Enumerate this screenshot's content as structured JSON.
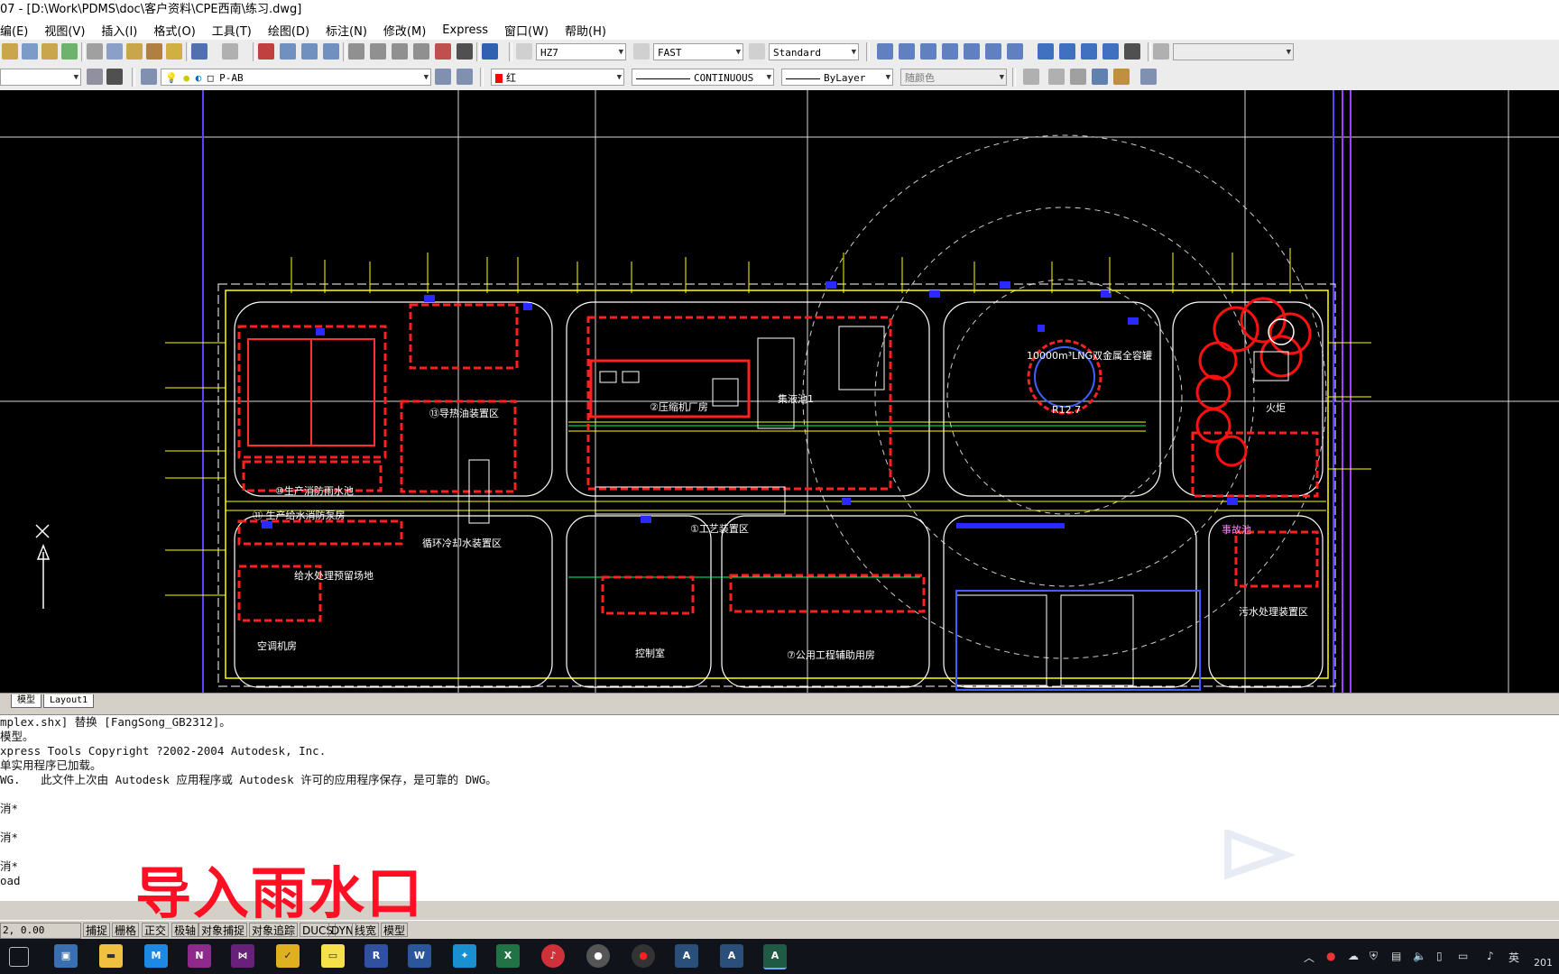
{
  "window": {
    "title": "07 - [D:\\Work\\PDMS\\doc\\客户资料\\CPE西南\\练习.dwg]"
  },
  "menu": [
    "编(E)",
    "视图(V)",
    "插入(I)",
    "格式(O)",
    "工具(T)",
    "绘图(D)",
    "标注(N)",
    "修改(M)",
    "Express",
    "窗口(W)",
    "帮助(H)"
  ],
  "toolbar1": {
    "text_style": "HZ7",
    "dim_style": "FAST",
    "table_style": "Standard"
  },
  "toolbar2": {
    "layer": "P-AB",
    "color": "红",
    "linetype": "CONTINUOUS",
    "lineweight": "ByLayer",
    "plotstyle": "随颜色"
  },
  "drawing": {
    "labels": {
      "a": "⑩生产消防雨水池",
      "b": "⑪ 生产给水消防泵房",
      "c": "⑬导热油装置区",
      "d": "循环冷却水装置区",
      "e": "②压缩机厂房",
      "f": "①工艺装置区",
      "g": "10000m³LNG双金属全容罐",
      "h": "火炬",
      "i": "给水处理预留场地",
      "j": "污水处理装置区",
      "k": "空调机房",
      "l": "控制室",
      "m": "⑦公用工程辅助用房",
      "n": "事故池",
      "o": "集液池1",
      "p": "R12.7"
    }
  },
  "tabs": {
    "model": "模型",
    "layout1": "Layout1"
  },
  "command_lines": [
    "mplex.shx] 替换 [FangSong_GB2312]。",
    "模型。",
    "xpress Tools Copyright ?2002-2004 Autodesk, Inc.",
    "单实用程序已加载。",
    "WG.   此文件上次由 Autodesk 应用程序或 Autodesk 许可的应用程序保存，是可靠的 DWG。",
    "",
    "消*",
    "",
    "消*",
    "",
    "消*",
    "oad"
  ],
  "overlay_text": "导入雨水口",
  "status": {
    "coord": "2, 0.00",
    "buttons": [
      "捕捉",
      "栅格",
      "正交",
      "极轴",
      "对象捕捉",
      "对象追踪",
      "DUCS",
      "DYN",
      "线宽",
      "模型"
    ]
  },
  "taskbar": {
    "ime": "英",
    "clock": "201"
  },
  "colors": {
    "accent_red": "#ff0f24",
    "cad_yellow": "#ffff00",
    "cad_blue": "#2a2aff",
    "cad_red": "#ff0000"
  },
  "icons": [
    "windows-task-view-icon",
    "explorer-icon",
    "mail-icon",
    "onenote-icon",
    "visual-studio-icon",
    "norton-icon",
    "sticky-notes-icon",
    "word-icon",
    "excel-icon",
    "netease-music-icon",
    "record-icon",
    "autocad-icon"
  ]
}
